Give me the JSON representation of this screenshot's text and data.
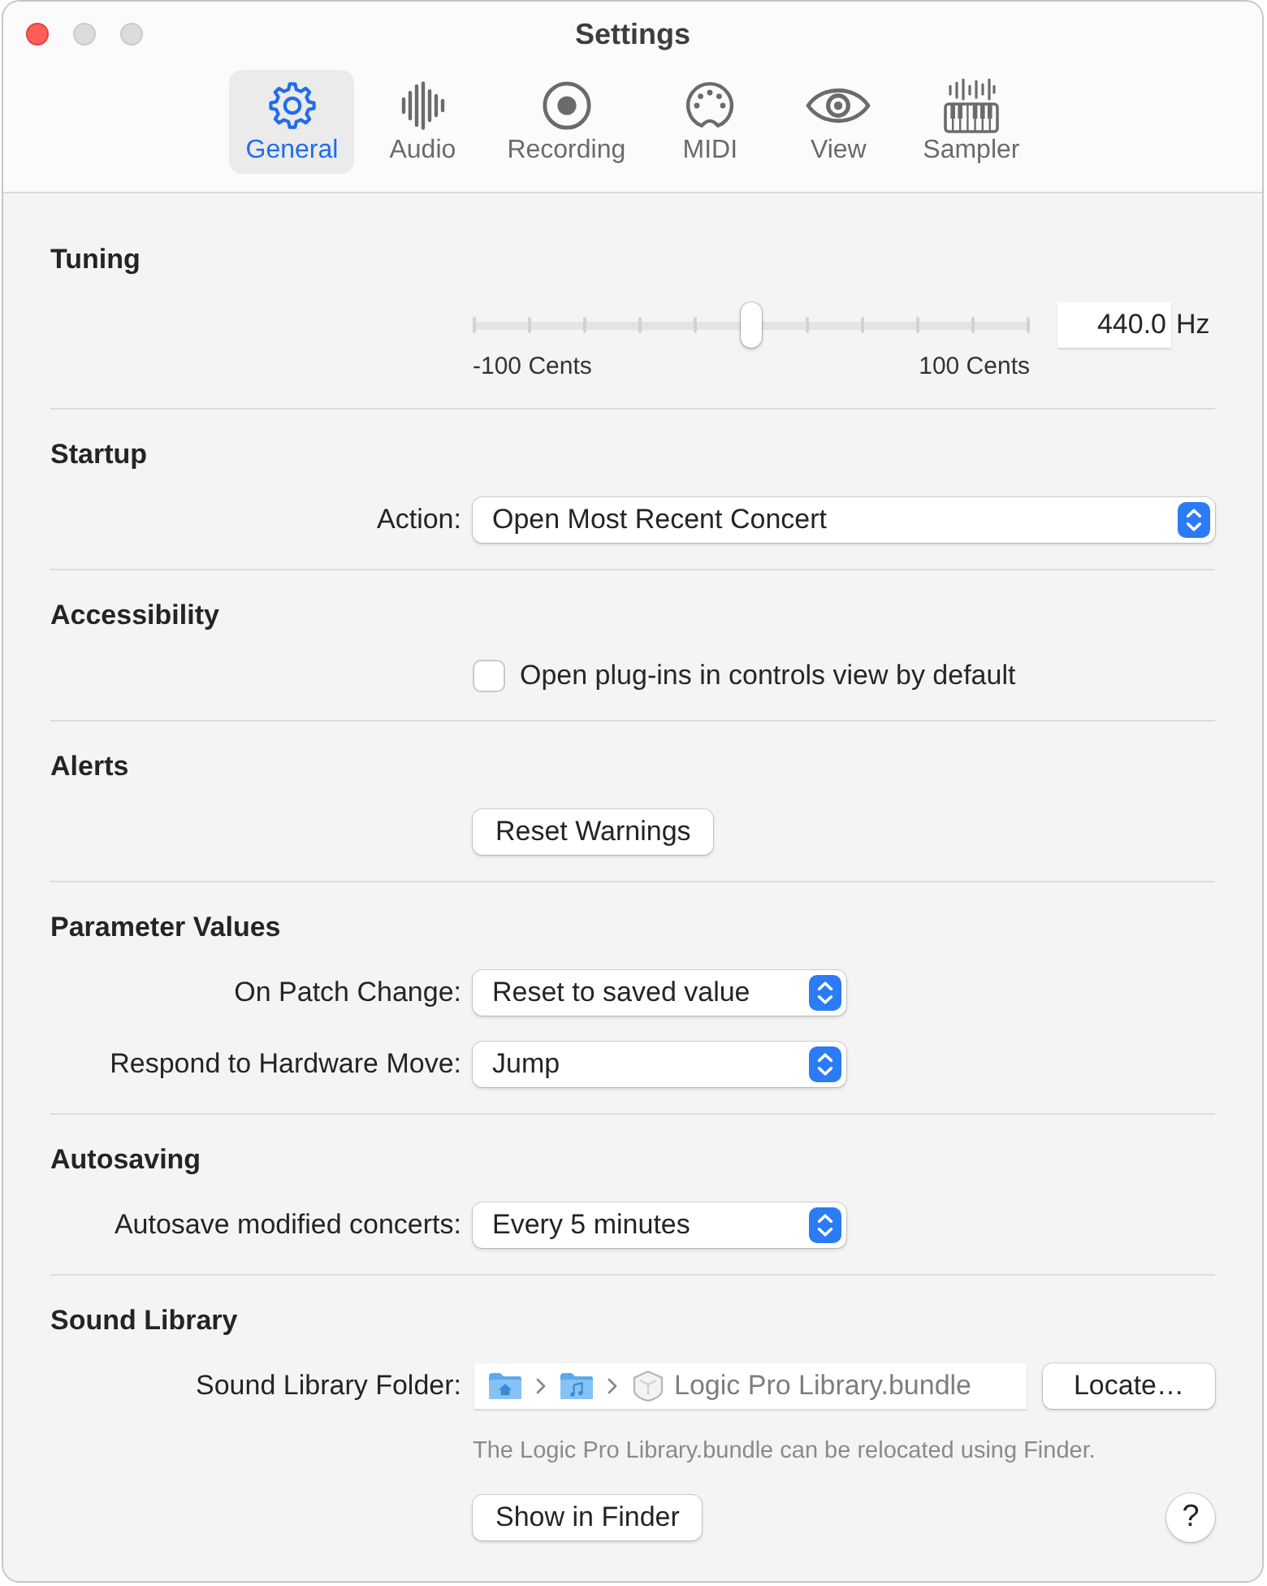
{
  "window": {
    "title": "Settings",
    "controls": [
      {
        "kind": "close",
        "disabled": false
      },
      {
        "kind": "minimize",
        "disabled": true
      },
      {
        "kind": "zoom",
        "disabled": true
      }
    ]
  },
  "toolbar": {
    "tabs": [
      {
        "label": "General",
        "selected": true
      },
      {
        "label": "Audio",
        "selected": false
      },
      {
        "label": "Recording",
        "selected": false
      },
      {
        "label": "MIDI",
        "selected": false
      },
      {
        "label": "View",
        "selected": false
      },
      {
        "label": "Sampler",
        "selected": false
      }
    ]
  },
  "sections": [
    {
      "heading": "Tuning",
      "rows": [
        {
          "kind": "slider",
          "level": 0.5,
          "min_label": "-100 Cents",
          "max_label": "100 Cents",
          "value": "440.0",
          "unit": "Hz"
        }
      ]
    },
    {
      "heading": "Startup",
      "rows": [
        {
          "kind": "popup",
          "label": "Action:",
          "value": "Open Most Recent Concert"
        }
      ]
    },
    {
      "heading": "Accessibility",
      "rows": [
        {
          "kind": "checkbox",
          "label": "Open plug-ins in controls view by default",
          "checked": false
        }
      ]
    },
    {
      "heading": "Alerts",
      "rows": [
        {
          "kind": "button",
          "label": "Reset Warnings"
        }
      ]
    },
    {
      "heading": "Parameter Values",
      "rows": [
        {
          "kind": "popup",
          "label": "On Patch Change:",
          "value": "Reset to saved value"
        },
        {
          "kind": "popup",
          "label": "Respond to Hardware Move:",
          "value": "Jump"
        }
      ]
    },
    {
      "heading": "Autosaving",
      "rows": [
        {
          "kind": "popup",
          "label": "Autosave modified concerts:",
          "value": "Every 5 minutes"
        }
      ]
    },
    {
      "heading": "Sound Library",
      "rows": [
        {
          "kind": "path",
          "label": "Sound Library Folder:",
          "path_item": "Logic Pro Library.bundle",
          "button": "Locate…"
        },
        {
          "kind": "note",
          "text": "The Logic Pro Library.bundle can be relocated using Finder."
        },
        {
          "kind": "button",
          "label": "Show in Finder",
          "help": "?"
        }
      ]
    }
  ]
}
